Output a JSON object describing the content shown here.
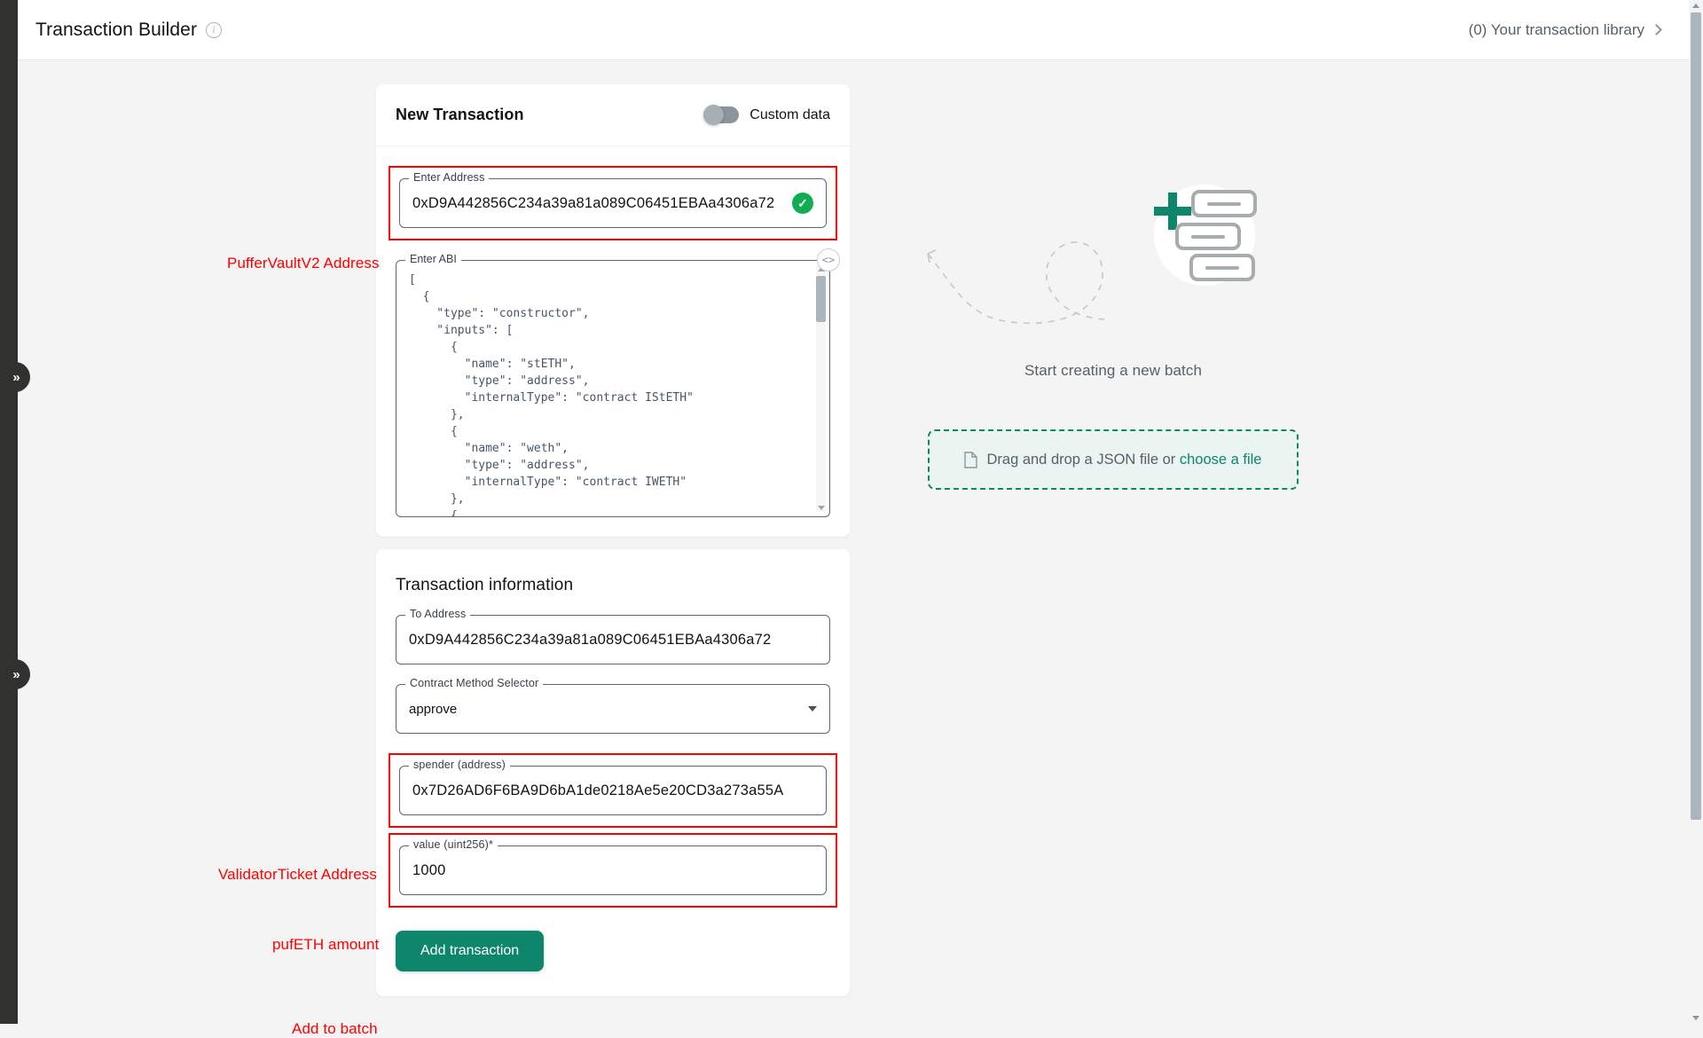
{
  "header": {
    "title": "Transaction Builder",
    "info_icon": "info-icon",
    "library_link": "(0) Your transaction library"
  },
  "rail": {
    "toggle_icon": "»"
  },
  "new_transaction": {
    "title": "New Transaction",
    "custom_data_label": "Custom data",
    "custom_data_on": false,
    "address_field": {
      "legend": "Enter Address",
      "value": "0xD9A442856C234a39a81a089C06451EBAa4306a72",
      "valid_icon": "check-circle-icon"
    },
    "abi_field": {
      "legend": "Enter ABI",
      "code_icon": "<>",
      "value": "[\n  {\n    \"type\": \"constructor\",\n    \"inputs\": [\n      {\n        \"name\": \"stETH\",\n        \"type\": \"address\",\n        \"internalType\": \"contract IStETH\"\n      },\n      {\n        \"name\": \"weth\",\n        \"type\": \"address\",\n        \"internalType\": \"contract IWETH\"\n      },\n      {\n        \"name\": \"lidoWithdrawalQueue\","
    }
  },
  "transaction_information": {
    "title": "Transaction information",
    "to_address": {
      "legend": "To Address",
      "value": "0xD9A442856C234a39a81a089C06451EBAa4306a72"
    },
    "method_selector": {
      "legend": "Contract Method Selector",
      "value": "approve"
    },
    "spender": {
      "legend": "spender (address)",
      "value": "0x7D26AD6F6BA9D6bA1de0218Ae5e20CD3a273a55A"
    },
    "amount": {
      "legend": "value (uint256)*",
      "value": "1000"
    },
    "submit_label": "Add transaction"
  },
  "right_panel": {
    "caption": "Start creating a new batch",
    "dropzone_text": "Drag and drop a JSON file or ",
    "dropzone_link": "choose a file",
    "file_icon": "file-icon"
  },
  "annotations": {
    "puffer_vault": "PufferVaultV2 Address",
    "validator_ticket": "ValidatorTicket Address",
    "pufeth_amount": "pufETH amount",
    "add_to_batch": "Add to batch"
  },
  "colors": {
    "accent": "#0d866b",
    "annotation": "#ff0000",
    "valid": "#12ad53",
    "rail": "#31312f"
  }
}
